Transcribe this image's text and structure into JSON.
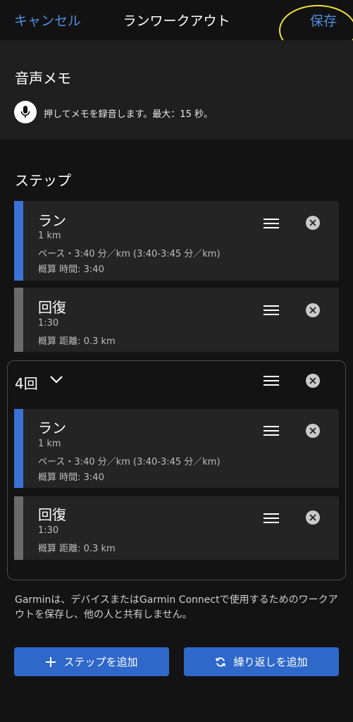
{
  "header": {
    "cancel_label": "キャンセル",
    "title": "ランワークアウト",
    "save_label": "保存"
  },
  "voice_memo": {
    "title": "音声メモ",
    "hint": "押してメモを録音します。最大：15 秒。"
  },
  "steps": {
    "title": "ステップ",
    "items": [
      {
        "label": "ラン",
        "line1": "1 km",
        "line2": "ペース・3:40 分／km (3:40-3:45 分／km)",
        "line3": "概算 時間: 3:40"
      },
      {
        "label": "回復",
        "line1": "1:30",
        "line2": "概算 距離: 0.3 km"
      }
    ]
  },
  "repeat": {
    "label": "4回",
    "items": [
      {
        "label": "ラン",
        "line1": "1 km",
        "line2": "ペース・3:40 分／km (3:40-3:45 分／km)",
        "line3": "概算 時間: 3:40"
      },
      {
        "label": "回復",
        "line1": "1:30",
        "line2": "概算 距離: 0.3 km"
      }
    ]
  },
  "footer_note": "Garminは、デバイスまたはGarmin Connectで使用するためのワークアウトを保存し、他の人と共有しません。",
  "buttons": {
    "add_step": "ステップを追加",
    "add_repeat": "繰り返しを追加"
  },
  "colors": {
    "accent": "#4f8fe0",
    "run_bar": "#3a72d6",
    "recovery_bar": "#6a6a6a",
    "button": "#2f68c9",
    "highlight": "#f2e13a"
  }
}
